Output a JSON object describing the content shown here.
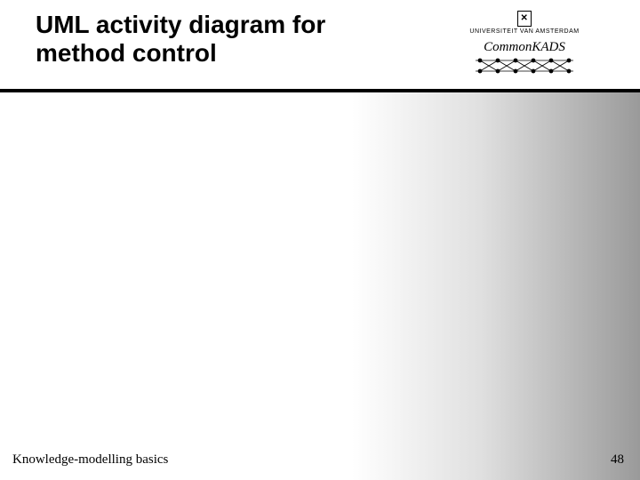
{
  "slide": {
    "title": "UML activity diagram for method control",
    "logos": {
      "uva_text": "UNIVERSITEIT VAN AMSTERDAM",
      "commonkads_text": "CommonKADS"
    },
    "footer": {
      "left": "Knowledge-modelling basics",
      "page_number": "48"
    }
  }
}
